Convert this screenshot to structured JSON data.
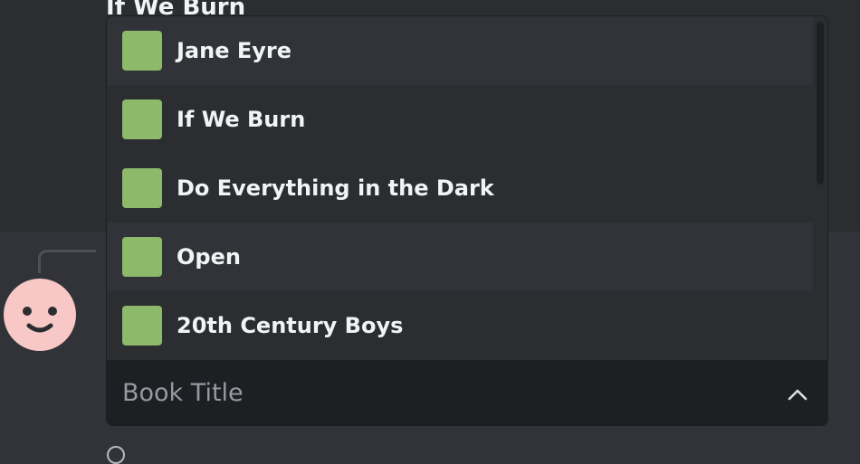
{
  "background_message": {
    "title_partial": "If We Burn"
  },
  "dropdown": {
    "options": [
      {
        "label": "Jane Eyre",
        "swatch_color": "#8db96a"
      },
      {
        "label": "If We Burn",
        "swatch_color": "#8db96a"
      },
      {
        "label": "Do Everything in the Dark",
        "swatch_color": "#8db96a"
      },
      {
        "label": "Open",
        "swatch_color": "#8db96a"
      },
      {
        "label": "20th Century Boys",
        "swatch_color": "#8db96a"
      }
    ],
    "placeholder": "Book Title",
    "chevron_icon": "chevron-up-icon"
  },
  "colors": {
    "accent_swatch": "#8db96a",
    "avatar": "#f7c8c5",
    "link": "#00a8fc"
  }
}
